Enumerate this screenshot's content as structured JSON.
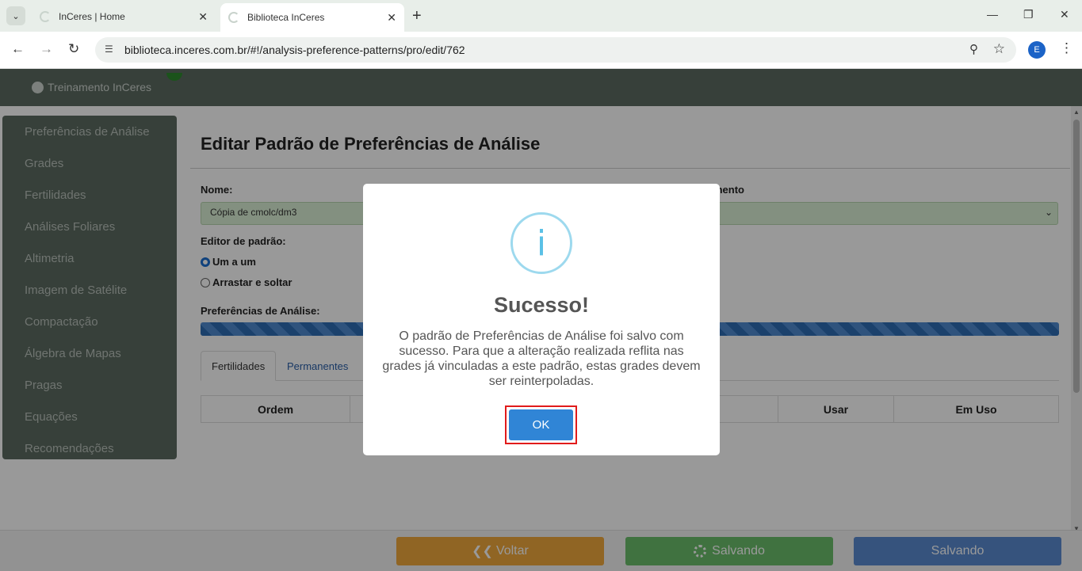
{
  "browser": {
    "tabs": [
      {
        "title": "InCeres | Home"
      },
      {
        "title": "Biblioteca InCeres"
      }
    ],
    "url": "biblioteca.inceres.com.br/#!/analysis-preference-patterns/pro/edit/762",
    "profile_initial": "E"
  },
  "app": {
    "user": "Treinamento InCeres",
    "sidebar": [
      {
        "label": "Preferências de Análise"
      },
      {
        "label": "Grades"
      },
      {
        "label": "Fertilidades"
      },
      {
        "label": "Análises Foliares"
      },
      {
        "label": "Altimetria"
      },
      {
        "label": "Imagem de Satélite"
      },
      {
        "label": "Compactação"
      },
      {
        "label": "Álgebra de Mapas"
      },
      {
        "label": "Pragas"
      },
      {
        "label": "Equações"
      },
      {
        "label": "Recomendações"
      }
    ],
    "page_title": "Editar Padrão de Preferências de Análise",
    "name_label": "Nome:",
    "name_value": "Cópia de cmolc/dm3",
    "second_label_partial": "mento",
    "editor_label": "Editor de padrão:",
    "radio_options": [
      {
        "label": "Um a um",
        "checked": true
      },
      {
        "label": "Arrastar e soltar",
        "checked": false
      }
    ],
    "prefs_label": "Preferências de Análise:",
    "tabs": [
      {
        "label": "Fertilidades"
      },
      {
        "label": "Permanentes"
      }
    ],
    "table_headers": [
      "Ordem",
      "",
      "Usar",
      "Em Uso"
    ],
    "footer": {
      "back_label": "Voltar",
      "saving_label": "Salvando",
      "saving2_label": "Salvando"
    }
  },
  "modal": {
    "title": "Sucesso!",
    "message": "O padrão de Preferências de Análise foi salvo com sucesso. Para que a alteração realizada reflita nas grades já vinculadas a este padrão, estas grades devem ser reinterpoladas.",
    "ok_label": "OK"
  },
  "colors": {
    "topbar": "#5c6b61",
    "ok_button": "#3085d6",
    "highlight": "#e11b1b",
    "info_icon": "#5ac0e6"
  }
}
